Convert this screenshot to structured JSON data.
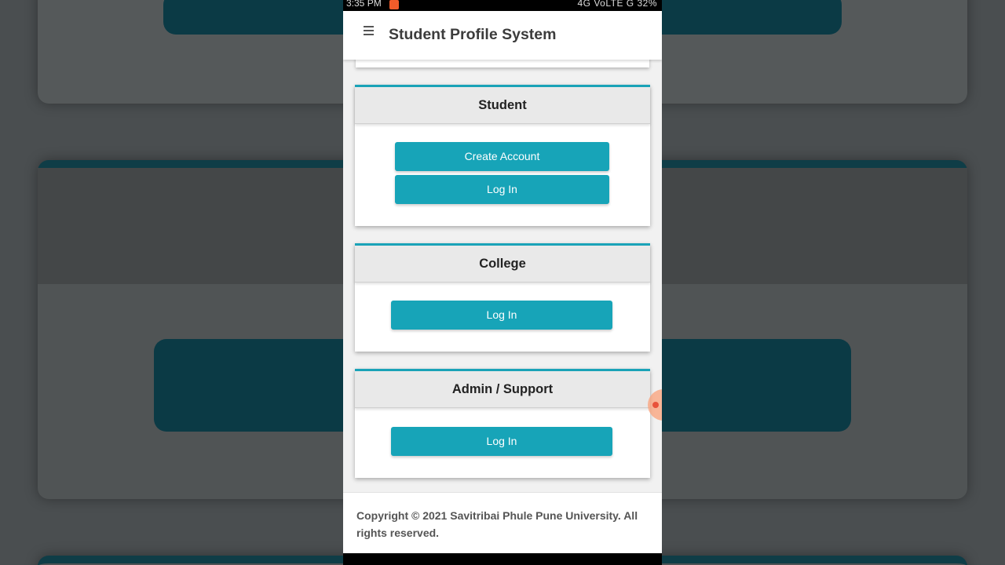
{
  "status_bar": {
    "time": "3:35 PM",
    "indicators": "4G VoLTE G 32%"
  },
  "app_bar": {
    "menu_icon": "hamburger-icon",
    "title": "Student Profile System"
  },
  "sections": [
    {
      "heading": "Student",
      "buttons": [
        "Create Account",
        "Log In"
      ]
    },
    {
      "heading": "College",
      "buttons": [
        "Log In"
      ]
    },
    {
      "heading": "Admin / Support",
      "buttons": [
        "Log In"
      ]
    }
  ],
  "footer": {
    "copyright": "Copyright © 2021 Savitribai Phule Pune University. All rights reserved."
  },
  "colors": {
    "accent": "#17a4b8",
    "card_header_bg": "#e9e9e9",
    "page_bg": "#f1f1f1"
  }
}
